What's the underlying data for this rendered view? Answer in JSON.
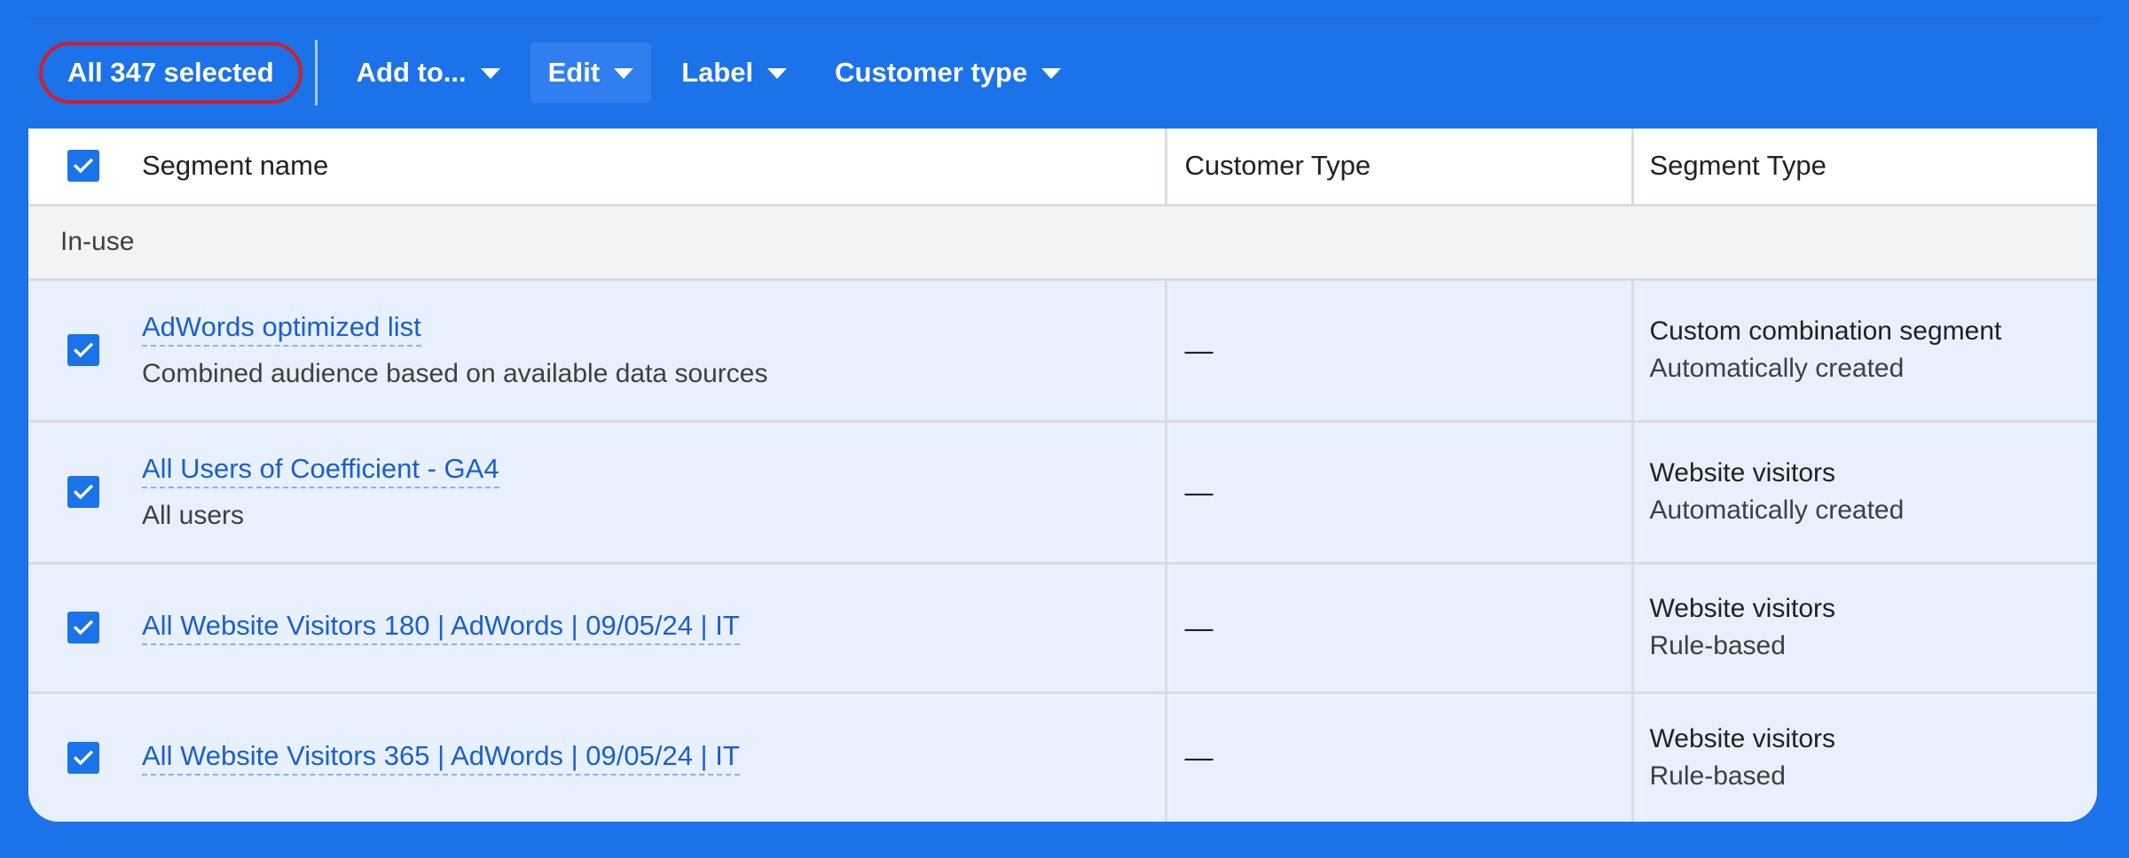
{
  "toolbar": {
    "selected_label": "All 347 selected",
    "add_to_label": "Add to...",
    "edit_label": "Edit",
    "label_label": "Label",
    "customer_type_label": "Customer type"
  },
  "table": {
    "headers": {
      "segment_name": "Segment name",
      "customer_type": "Customer Type",
      "segment_type": "Segment Type"
    },
    "group_label": "In-use",
    "rows": [
      {
        "name": "AdWords optimized list",
        "description": "Combined audience based on available data sources",
        "customer_type": "—",
        "segment_type": "Custom combination segment",
        "segment_type_sub": "Automatically created"
      },
      {
        "name": "All Users of Coefficient - GA4",
        "description": "All users",
        "customer_type": "—",
        "segment_type": "Website visitors",
        "segment_type_sub": "Automatically created"
      },
      {
        "name": "All Website Visitors 180 | AdWords | 09/05/24 | IT",
        "description": "",
        "customer_type": "—",
        "segment_type": "Website visitors",
        "segment_type_sub": "Rule-based"
      },
      {
        "name": "All Website Visitors 365 | AdWords | 09/05/24 | IT",
        "description": "",
        "customer_type": "—",
        "segment_type": "Website visitors",
        "segment_type_sub": "Rule-based"
      }
    ]
  },
  "colors": {
    "background": "#1b72e9",
    "accent": "#1a73e8",
    "highlight_ring": "#d21f2b",
    "selected_row": "#e8f0fe",
    "group_row": "#f1f3f4"
  }
}
